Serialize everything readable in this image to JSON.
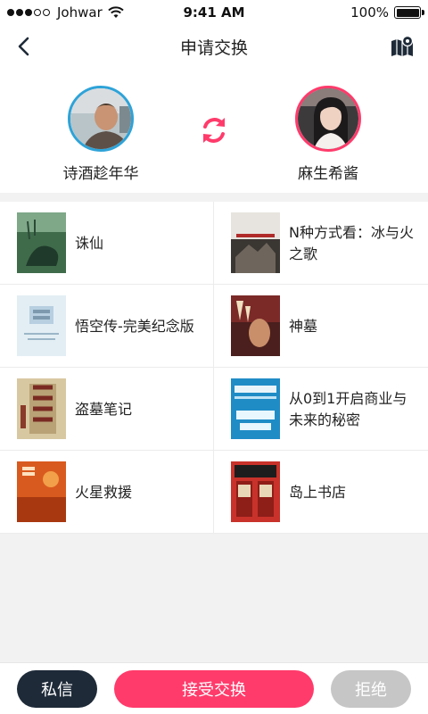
{
  "status_bar": {
    "carrier": "Johwar",
    "time": "9:41 AM",
    "battery": "100%"
  },
  "nav": {
    "title": "申请交换",
    "back_icon": "chevron-left-icon",
    "map_icon": "map-pin-icon"
  },
  "exchange": {
    "left_user": {
      "name": "诗酒趁年华"
    },
    "right_user": {
      "name": "麻生希酱"
    },
    "swap_icon": "swap-arrows-icon"
  },
  "books": [
    {
      "title": "诛仙"
    },
    {
      "title": "N种方式看：冰与火之歌"
    },
    {
      "title": "悟空传-完美纪念版"
    },
    {
      "title": "神墓"
    },
    {
      "title": "盗墓笔记"
    },
    {
      "title": "从0到1开启商业与未来的秘密"
    },
    {
      "title": "火星救援"
    },
    {
      "title": "岛上书店"
    }
  ],
  "actions": {
    "message_label": "私信",
    "accept_label": "接受交换",
    "reject_label": "拒绝"
  },
  "colors": {
    "accent_pink": "#ff3b6b",
    "accent_blue": "#2ea3d8",
    "dark_button": "#1e2a38",
    "disabled_button": "#c6c6c6"
  }
}
